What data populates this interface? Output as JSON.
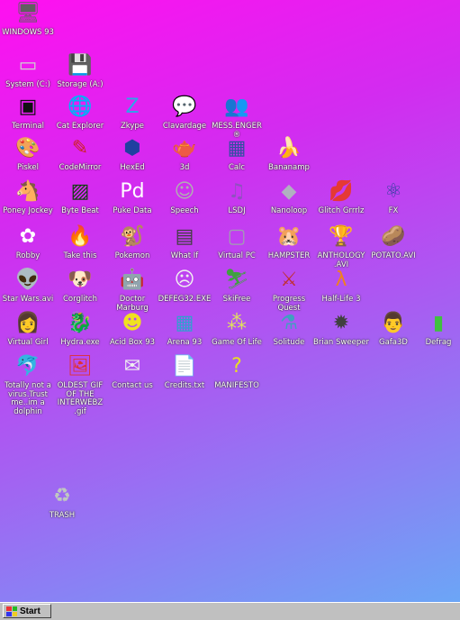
{
  "desktop_icons": [
    {
      "label": "WINDOWS 93",
      "glyph": "🖥",
      "color": "#606060"
    },
    {
      "label": "System (C:)",
      "glyph": "▭",
      "color": "#d0d0d0"
    },
    {
      "label": "Storage (A:)",
      "glyph": "💾",
      "color": "#d0d0d0"
    },
    {
      "label": "Terminal",
      "glyph": "▣",
      "color": "#111111"
    },
    {
      "label": "Cat Explorer",
      "glyph": "🌐",
      "color": "#2a8a3a"
    },
    {
      "label": "Zkype",
      "glyph": "Z",
      "color": "#2aa8e8"
    },
    {
      "label": "Clavardage",
      "glyph": "💬",
      "color": "#e8b020"
    },
    {
      "label": "MESS.ENGER ®",
      "glyph": "👥",
      "color": "#8844cc"
    },
    {
      "label": "Piskel",
      "glyph": "🎨",
      "color": "#e04090"
    },
    {
      "label": "CodeMirror",
      "glyph": "✎",
      "color": "#cc2222"
    },
    {
      "label": "HexEd",
      "glyph": "⬢",
      "color": "#2040a0"
    },
    {
      "label": "3d",
      "glyph": "🫖",
      "color": "#e8a090"
    },
    {
      "label": "Calc",
      "glyph": "▦",
      "color": "#3050a0"
    },
    {
      "label": "Bananamp",
      "glyph": "🍌",
      "color": "#f0e020"
    },
    {
      "label": "Poney Jockey",
      "glyph": "🐴",
      "color": "#c070d0"
    },
    {
      "label": "Byte Beat",
      "glyph": "▨",
      "color": "#104010"
    },
    {
      "label": "Puke Data",
      "glyph": "Pd",
      "color": "#ffffff"
    },
    {
      "label": "Speech",
      "glyph": "☺",
      "color": "#b0b0b0"
    },
    {
      "label": "LSDJ",
      "glyph": "♫",
      "color": "#9050c0"
    },
    {
      "label": "Nanoloop",
      "glyph": "◆",
      "color": "#b0b0c0"
    },
    {
      "label": "Glitch Grrrlz",
      "glyph": "💋",
      "color": "#e02040"
    },
    {
      "label": "FX",
      "glyph": "⚛",
      "color": "#3040a0"
    },
    {
      "label": "Robby",
      "glyph": "✿",
      "color": "#ffffff"
    },
    {
      "label": "Take this",
      "glyph": "🔥",
      "color": "#ff4010"
    },
    {
      "label": "Pokemon",
      "glyph": "🐒",
      "color": "#a06020"
    },
    {
      "label": "What If",
      "glyph": "▤",
      "color": "#404040"
    },
    {
      "label": "Virtual PC",
      "glyph": "▢",
      "color": "#a0a0b0"
    },
    {
      "label": "HAMPSTER",
      "glyph": "🐹",
      "color": "#e0c0a0"
    },
    {
      "label": "ANTHOLOGY .AVI",
      "glyph": "🏆",
      "color": "#e0b000"
    },
    {
      "label": "POTATO.AVI",
      "glyph": "🥔",
      "color": "#b08040"
    },
    {
      "label": "Star Wars.avi",
      "glyph": "👽",
      "color": "#60a040"
    },
    {
      "label": "Corglitch",
      "glyph": "🐶",
      "color": "#e0a050"
    },
    {
      "label": "Doctor Marburg",
      "glyph": "🤖",
      "color": "#b04020"
    },
    {
      "label": "DEFEG32.EXE",
      "glyph": "☹",
      "color": "#f0f0f0"
    },
    {
      "label": "SkiFree",
      "glyph": "⛷",
      "color": "#40a040"
    },
    {
      "label": "Progress Quest",
      "glyph": "⚔",
      "color": "#c03030"
    },
    {
      "label": "Half-Life 3",
      "glyph": "λ",
      "color": "#f08020"
    },
    {
      "label": "Virtual Girl",
      "glyph": "👩",
      "color": "#f0c0a0"
    },
    {
      "label": "Hydra.exe",
      "glyph": "🐉",
      "color": "#208040"
    },
    {
      "label": "Acid Box 93",
      "glyph": "☻",
      "color": "#f0e020"
    },
    {
      "label": "Arena 93",
      "glyph": "▦",
      "color": "#30a0d0"
    },
    {
      "label": "Game Of Life",
      "glyph": "⁂",
      "color": "#e0e060"
    },
    {
      "label": "Solitude",
      "glyph": "⚗",
      "color": "#40a0c0"
    },
    {
      "label": "Brian Sweeper",
      "glyph": "✹",
      "color": "#404040"
    },
    {
      "label": "Gafa3D",
      "glyph": "👨",
      "color": "#d08050"
    },
    {
      "label": "Defrag",
      "glyph": "▮",
      "color": "#40c040"
    },
    {
      "label": "Totally not a virus.Trust me..im a dolphin",
      "glyph": "🐬",
      "color": "#4080e0"
    },
    {
      "label": "OLDEST GIF OF THE INTERWEBZ .gif",
      "glyph": "🖼",
      "color": "#e03030"
    },
    {
      "label": "Contact us",
      "glyph": "✉",
      "color": "#f0f0f0"
    },
    {
      "label": "Credits.txt",
      "glyph": "📄",
      "color": "#f0f0f0"
    },
    {
      "label": "MANIFESTO",
      "glyph": "?",
      "color": "#e8e020"
    },
    {
      "label": "TRASH",
      "glyph": "♻",
      "color": "#c0c8c0"
    }
  ],
  "taskbar": {
    "start_label": "Start"
  }
}
